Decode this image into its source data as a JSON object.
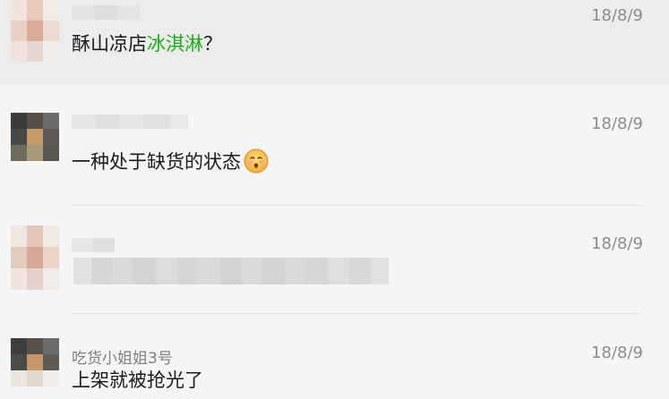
{
  "comments": [
    {
      "nickname": "",
      "time": "18/8/9",
      "text_parts": [
        "酥山凉店",
        "冰淇淋",
        "？"
      ],
      "link_color": "#1aad19"
    },
    {
      "nickname": "",
      "time": "18/8/9",
      "text": "一种处于缺货的状态",
      "emoji": "slightly-smiling-face-emoji"
    },
    {
      "nickname": "",
      "time": "18/8/9",
      "text": ""
    },
    {
      "nickname": "吃货小姐姐3号",
      "time": "18/8/9",
      "text": "上架就被抢光了"
    }
  ],
  "colors": {
    "background": "#f5f5f5",
    "highlight_row": "#ececec",
    "link_green": "#1aad19",
    "time_gray": "#8c8c8c",
    "nickname_gray": "#7f7f7f"
  }
}
